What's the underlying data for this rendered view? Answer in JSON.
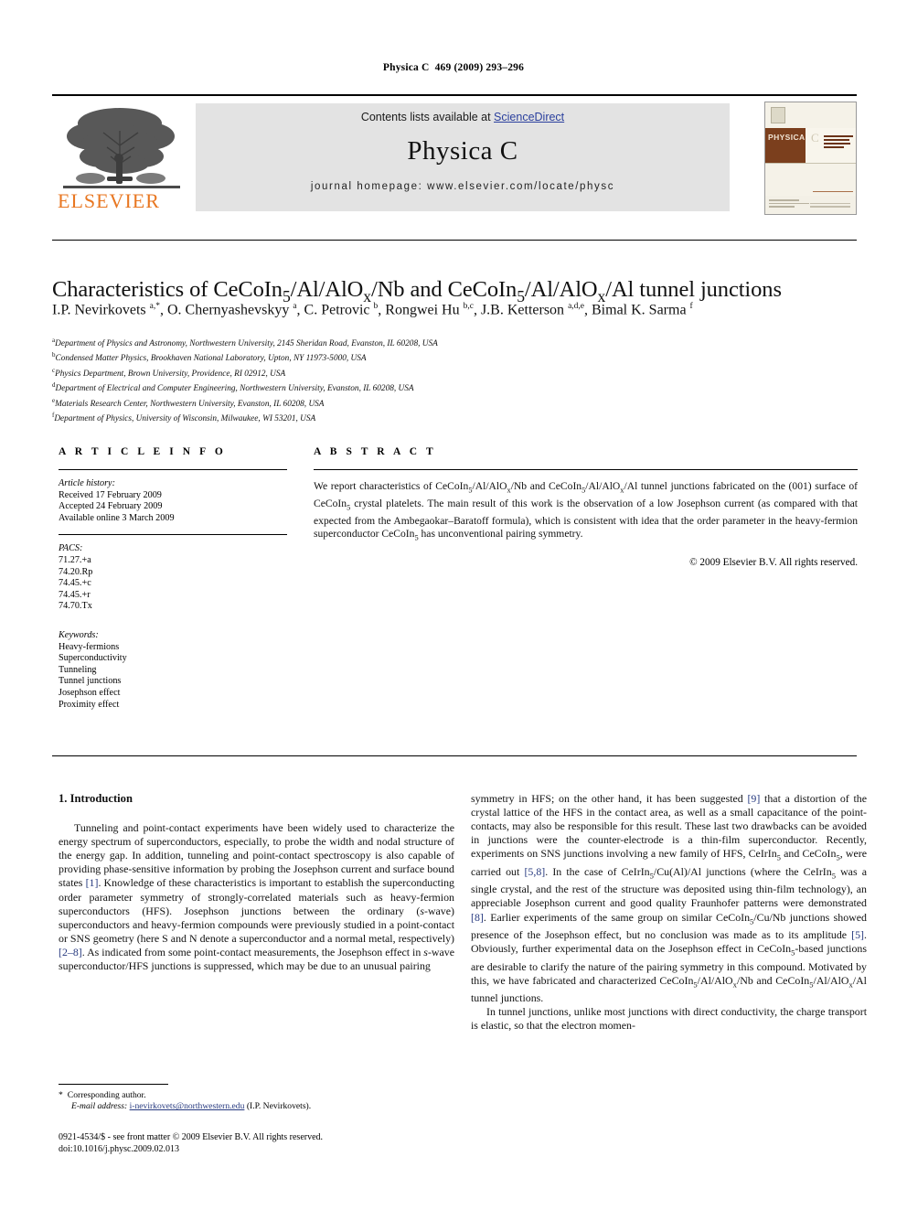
{
  "running_head": {
    "journal": "Physica C",
    "volume_info": "469 (2009) 293–296"
  },
  "masthead": {
    "contents_prefix": "Contents lists available at ",
    "sciencedirect": "ScienceDirect",
    "journal_title": "Physica C",
    "homepage": "journal homepage: www.elsevier.com/locate/physc",
    "publisher_wordmark": "ELSEVIER",
    "cover_brand": "PHYSICA",
    "cover_letter": "C",
    "link_color": "#2a3f9d",
    "accent_color": "#E87722"
  },
  "article": {
    "title_html": "Characteristics of CeCoIn<sub>5</sub>/Al/AlO<sub>x</sub>/Nb and CeCoIn<sub>5</sub>/Al/AlO<sub>x</sub>/Al tunnel junctions",
    "authors_html": "I.P. Nevirkovets <sup>a,</sup><sup>*</sup>, O. Chernyashevskyy <sup>a</sup>, C. Petrovic <sup>b</sup>, Rongwei Hu <sup>b,c</sup>, J.B. Ketterson <sup>a,d,e</sup>, Bimal K. Sarma <sup>f</sup>",
    "affiliations": [
      {
        "mark": "a",
        "text": "Department of Physics and Astronomy, Northwestern University, 2145 Sheridan Road, Evanston, IL 60208, USA"
      },
      {
        "mark": "b",
        "text": "Condensed Matter Physics, Brookhaven National Laboratory, Upton, NY 11973-5000, USA"
      },
      {
        "mark": "c",
        "text": "Physics Department, Brown University, Providence, RI 02912, USA"
      },
      {
        "mark": "d",
        "text": "Department of Electrical and Computer Engineering, Northwestern University, Evanston, IL 60208, USA"
      },
      {
        "mark": "e",
        "text": "Materials Research Center, Northwestern University, Evanston, IL 60208, USA"
      },
      {
        "mark": "f",
        "text": "Department of Physics, University of Wisconsin, Milwaukee, WI 53201, USA"
      }
    ]
  },
  "article_info": {
    "heading": "A R T I C L E   I N F O",
    "history_label": "Article history:",
    "history": [
      "Received 17 February 2009",
      "Accepted 24 February 2009",
      "Available online 3 March 2009"
    ],
    "pacs_label": "PACS:",
    "pacs": [
      "71.27.+a",
      "74.20.Rp",
      "74.45.+c",
      "74.45.+r",
      "74.70.Tx"
    ],
    "keywords_label": "Keywords:",
    "keywords": [
      "Heavy-fermions",
      "Superconductivity",
      "Tunneling",
      "Tunnel junctions",
      "Josephson effect",
      "Proximity effect"
    ]
  },
  "abstract": {
    "heading": "A B S T R A C T",
    "text_html": "We report characteristics of CeCoIn<sub>5</sub>/Al/AlO<sub>x</sub>/Nb and CeCoIn<sub>5</sub>/Al/AlO<sub>x</sub>/Al tunnel junctions fabricated on the (001) surface of CeCoIn<sub>5</sub> crystal platelets. The main result of this work is the observation of a low Josephson current (as compared with that expected from the Ambegaokar–Baratoff formula), which is consistent with idea that the order parameter in the heavy-fermion superconductor CeCoIn<sub>5</sub> has unconventional pairing symmetry.",
    "copyright": "© 2009 Elsevier B.V. All rights reserved."
  },
  "body": {
    "section_heading": "1. Introduction",
    "left_paragraphs_html": [
      "Tunneling and point-contact experiments have been widely used to characterize the energy spectrum of superconductors, especially, to probe the width and nodal structure of the energy gap. In addition, tunneling and point-contact spectroscopy is also capable of providing phase-sensitive information by probing the Josephson current and surface bound states <span class=\"ref\">[1]</span>. Knowledge of these characteristics is important to establish the superconducting order parameter symmetry of strongly-correlated materials such as heavy-fermion superconductors (HFS). Josephson junctions between the ordinary (<i>s</i>-wave) superconductors and heavy-fermion compounds were previously studied in a point-contact or SNS geometry (here S and N denote a superconductor and a normal metal, respectively) <span class=\"ref\">[2–8]</span>. As indicated from some point-contact measurements, the Josephson effect in <i>s</i>-wave superconductor/HFS junctions is suppressed, which may be due to an unusual pairing"
    ],
    "right_paragraphs_html": [
      "symmetry in HFS; on the other hand, it has been suggested <span class=\"ref\">[9]</span> that a distortion of the crystal lattice of the HFS in the contact area, as well as a small capacitance of the point-contacts, may also be responsible for this result. These last two drawbacks can be avoided in junctions were the counter-electrode is a thin-film superconductor. Recently, experiments on SNS junctions involving a new family of HFS, CeIrIn<sub>5</sub> and CeCoIn<sub>5</sub>, were carried out <span class=\"ref\">[5,8]</span>. In the case of CeIrIn<sub>5</sub>/Cu(Al)/Al junctions (where the CeIrIn<sub>5</sub> was a single crystal, and the rest of the structure was deposited using thin-film technology), an appreciable Josephson current and good quality Fraunhofer patterns were demonstrated <span class=\"ref\">[8]</span>. Earlier experiments of the same group on similar CeCoIn<sub>5</sub>/Cu/Nb junctions showed presence of the Josephson effect, but no conclusion was made as to its amplitude <span class=\"ref\">[5]</span>. Obviously, further experimental data on the Josephson effect in CeCoIn<sub>5</sub>-based junctions are desirable to clarify the nature of the pairing symmetry in this compound. Motivated by this, we have fabricated and characterized CeCoIn<sub>5</sub>/Al/AlO<sub>x</sub>/Nb and CeCoIn<sub>5</sub>/Al/AlO<sub>x</sub>/Al tunnel junctions.",
      "In tunnel junctions, unlike most junctions with direct conductivity, the charge transport is elastic, so that the electron momen-"
    ]
  },
  "footnote": {
    "corresponding_label": "Corresponding author.",
    "email_label": "E-mail address:",
    "email": "i-nevirkovets@northwestern.edu",
    "email_owner": "(I.P. Nevirkovets)."
  },
  "imprint": {
    "line1": "0921-4534/$ - see front matter © 2009 Elsevier B.V. All rights reserved.",
    "line2": "doi:10.1016/j.physc.2009.02.013"
  }
}
